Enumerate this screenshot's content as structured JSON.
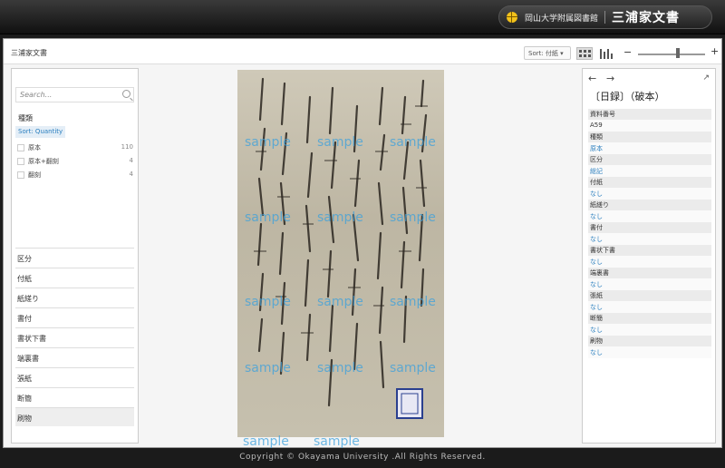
{
  "header": {
    "library": "岡山大学附属図書館",
    "collection": "三浦家文書"
  },
  "toolbar": {
    "breadcrumb": "三浦家文書",
    "sort": "Sort: 付紙 ▾"
  },
  "left": {
    "search_placeholder": "Search...",
    "facet_title": "種類",
    "sort_label": "Sort: Quantity",
    "options": [
      {
        "label": "原本",
        "count": "110"
      },
      {
        "label": "原本+翻刻",
        "count": "4"
      },
      {
        "label": "翻刻",
        "count": "4"
      }
    ],
    "facets": [
      "区分",
      "付紙",
      "紙縒り",
      "書付",
      "書状下書",
      "端裏書",
      "張紙",
      "断簡",
      "刷物"
    ]
  },
  "viewer": {
    "watermark": "sample"
  },
  "right": {
    "title": "〔日録〕（破本）",
    "meta": [
      {
        "key": "資料番号",
        "value": "A59"
      },
      {
        "key": "種類",
        "value": "原本"
      },
      {
        "key": "区分",
        "value": "総記"
      },
      {
        "key": "付紙",
        "value": "なし"
      },
      {
        "key": "紙縒り",
        "value": "なし"
      },
      {
        "key": "書付",
        "value": "なし"
      },
      {
        "key": "書状下書",
        "value": "なし"
      },
      {
        "key": "端裏書",
        "value": "なし"
      },
      {
        "key": "張紙",
        "value": "なし"
      },
      {
        "key": "断簡",
        "value": "なし"
      },
      {
        "key": "刷物",
        "value": "なし"
      }
    ]
  },
  "footer": "Copyright © Okayama University .All Rights Reserved."
}
